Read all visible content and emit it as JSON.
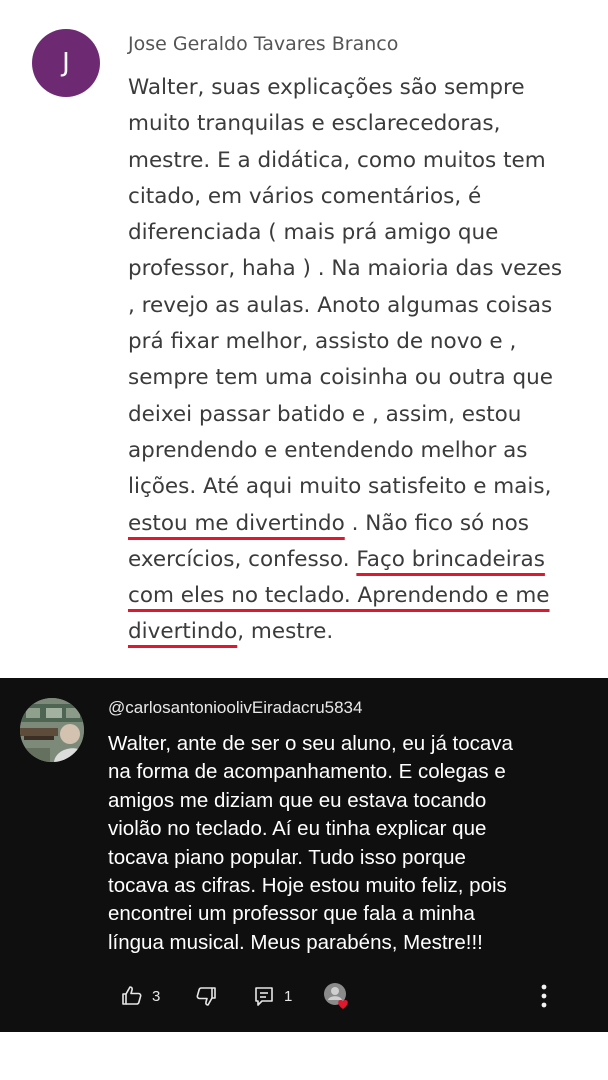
{
  "comment1": {
    "avatar_letter": "J",
    "avatar_color": "#6d2a73",
    "author": "Jose Geraldo Tavares Branco",
    "underline_color": "#e0172d",
    "lines": [
      "Walter, suas explicações são sempre",
      "muito tranquilas e esclarecedoras,",
      "mestre. E a didática, como muitos tem",
      "citado, em vários comentários, é",
      "diferenciada ( mais prá amigo que",
      "professor, haha ) . Na maioria das vezes",
      ", revejo as aulas. Anoto algumas coisas",
      "prá fixar melhor, assisto de novo e ,",
      "sempre tem uma coisinha ou outra que",
      "deixei passar batido e , assim, estou",
      "aprendendo e entendendo melhor as",
      "lições. Até aqui muito satisfeito e mais,"
    ],
    "line13_underlined": "estou me divertindo",
    "line13_rest": " . Não fico só nos",
    "line14_plain": "exercícios, confesso. ",
    "line14_underlined": "Faço brincadeiras",
    "line15_underlined": "com eles no teclado. Aprendendo e me",
    "line16_underlined": "divertindo",
    "line16_rest": ", mestre."
  },
  "comment2": {
    "handle": "@carlosantonioolivEiradacru5834",
    "lines": [
      "Walter, ante de ser o seu aluno, eu já tocava",
      "na forma de acompanhamento. E colegas e",
      "amigos me diziam que eu estava tocando",
      "violão no teclado. Aí eu tinha explicar que",
      "tocava piano popular. Tudo isso porque",
      "tocava as cifras. Hoje estou muito feliz, pois",
      "encontrei um professor que fala a minha",
      "língua musical. Meus parabéns, Mestre!!!"
    ],
    "actions": {
      "like_icon": "thumbs-up-icon",
      "like_count": "3",
      "dislike_icon": "thumbs-down-icon",
      "reply_icon": "comment-icon",
      "reply_count": "1",
      "creator_heart_icon": "creator-heart-icon",
      "more_icon": "more-vertical-icon"
    }
  }
}
